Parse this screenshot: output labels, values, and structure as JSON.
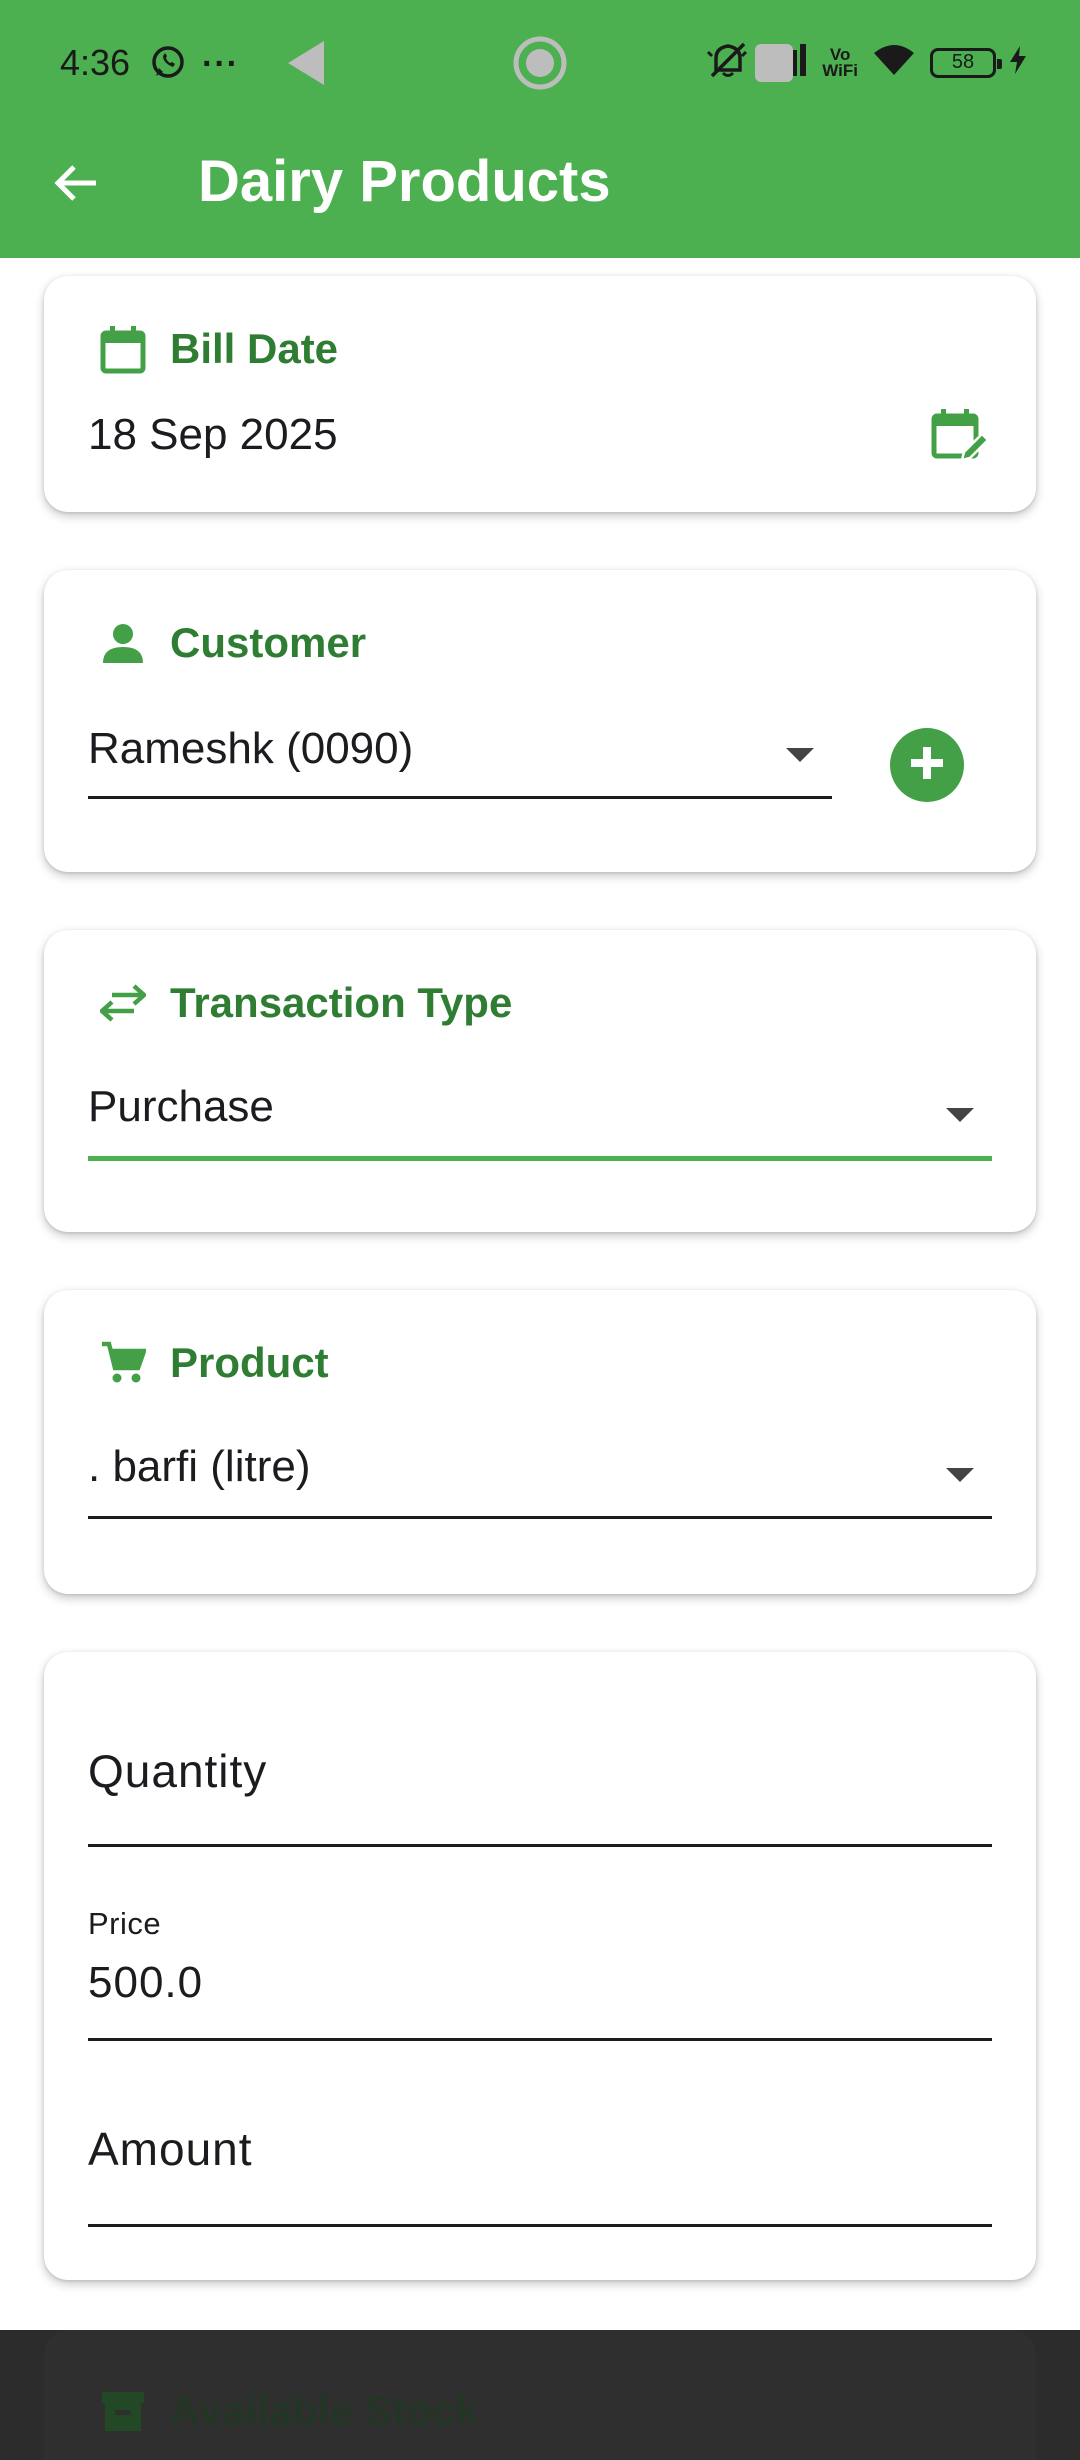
{
  "status_bar": {
    "time": "4:36",
    "more": "···",
    "vowifi_top": "Vo",
    "vowifi_bottom": "WiFi",
    "battery": "58"
  },
  "app_bar": {
    "title": "Dairy Products",
    "back_icon": "arrow-back-icon"
  },
  "bill_date": {
    "label": "Bill Date",
    "value": "18 Sep 2025",
    "icon": "calendar-icon",
    "edit_icon": "calendar-edit-icon"
  },
  "customer": {
    "label": "Customer",
    "selected": "Rameshk (0090)",
    "icon": "person-icon",
    "add_icon": "add-circle-icon"
  },
  "transaction_type": {
    "label": "Transaction Type",
    "selected": "Purchase",
    "icon": "swap-icon"
  },
  "product": {
    "label": "Product",
    "selected": ". barfi (litre)",
    "icon": "cart-icon"
  },
  "form": {
    "quantity_label": "Quantity",
    "quantity_value": "",
    "price_label": "Price",
    "price_value": "500.0",
    "amount_label": "Amount",
    "amount_value": ""
  },
  "available_stock": {
    "label": "Available Stock",
    "icon": "archive-icon"
  },
  "colors": {
    "primary": "#4caf50",
    "primary_dark": "#2e7d32",
    "nav_bar": "#2c2c2c"
  }
}
